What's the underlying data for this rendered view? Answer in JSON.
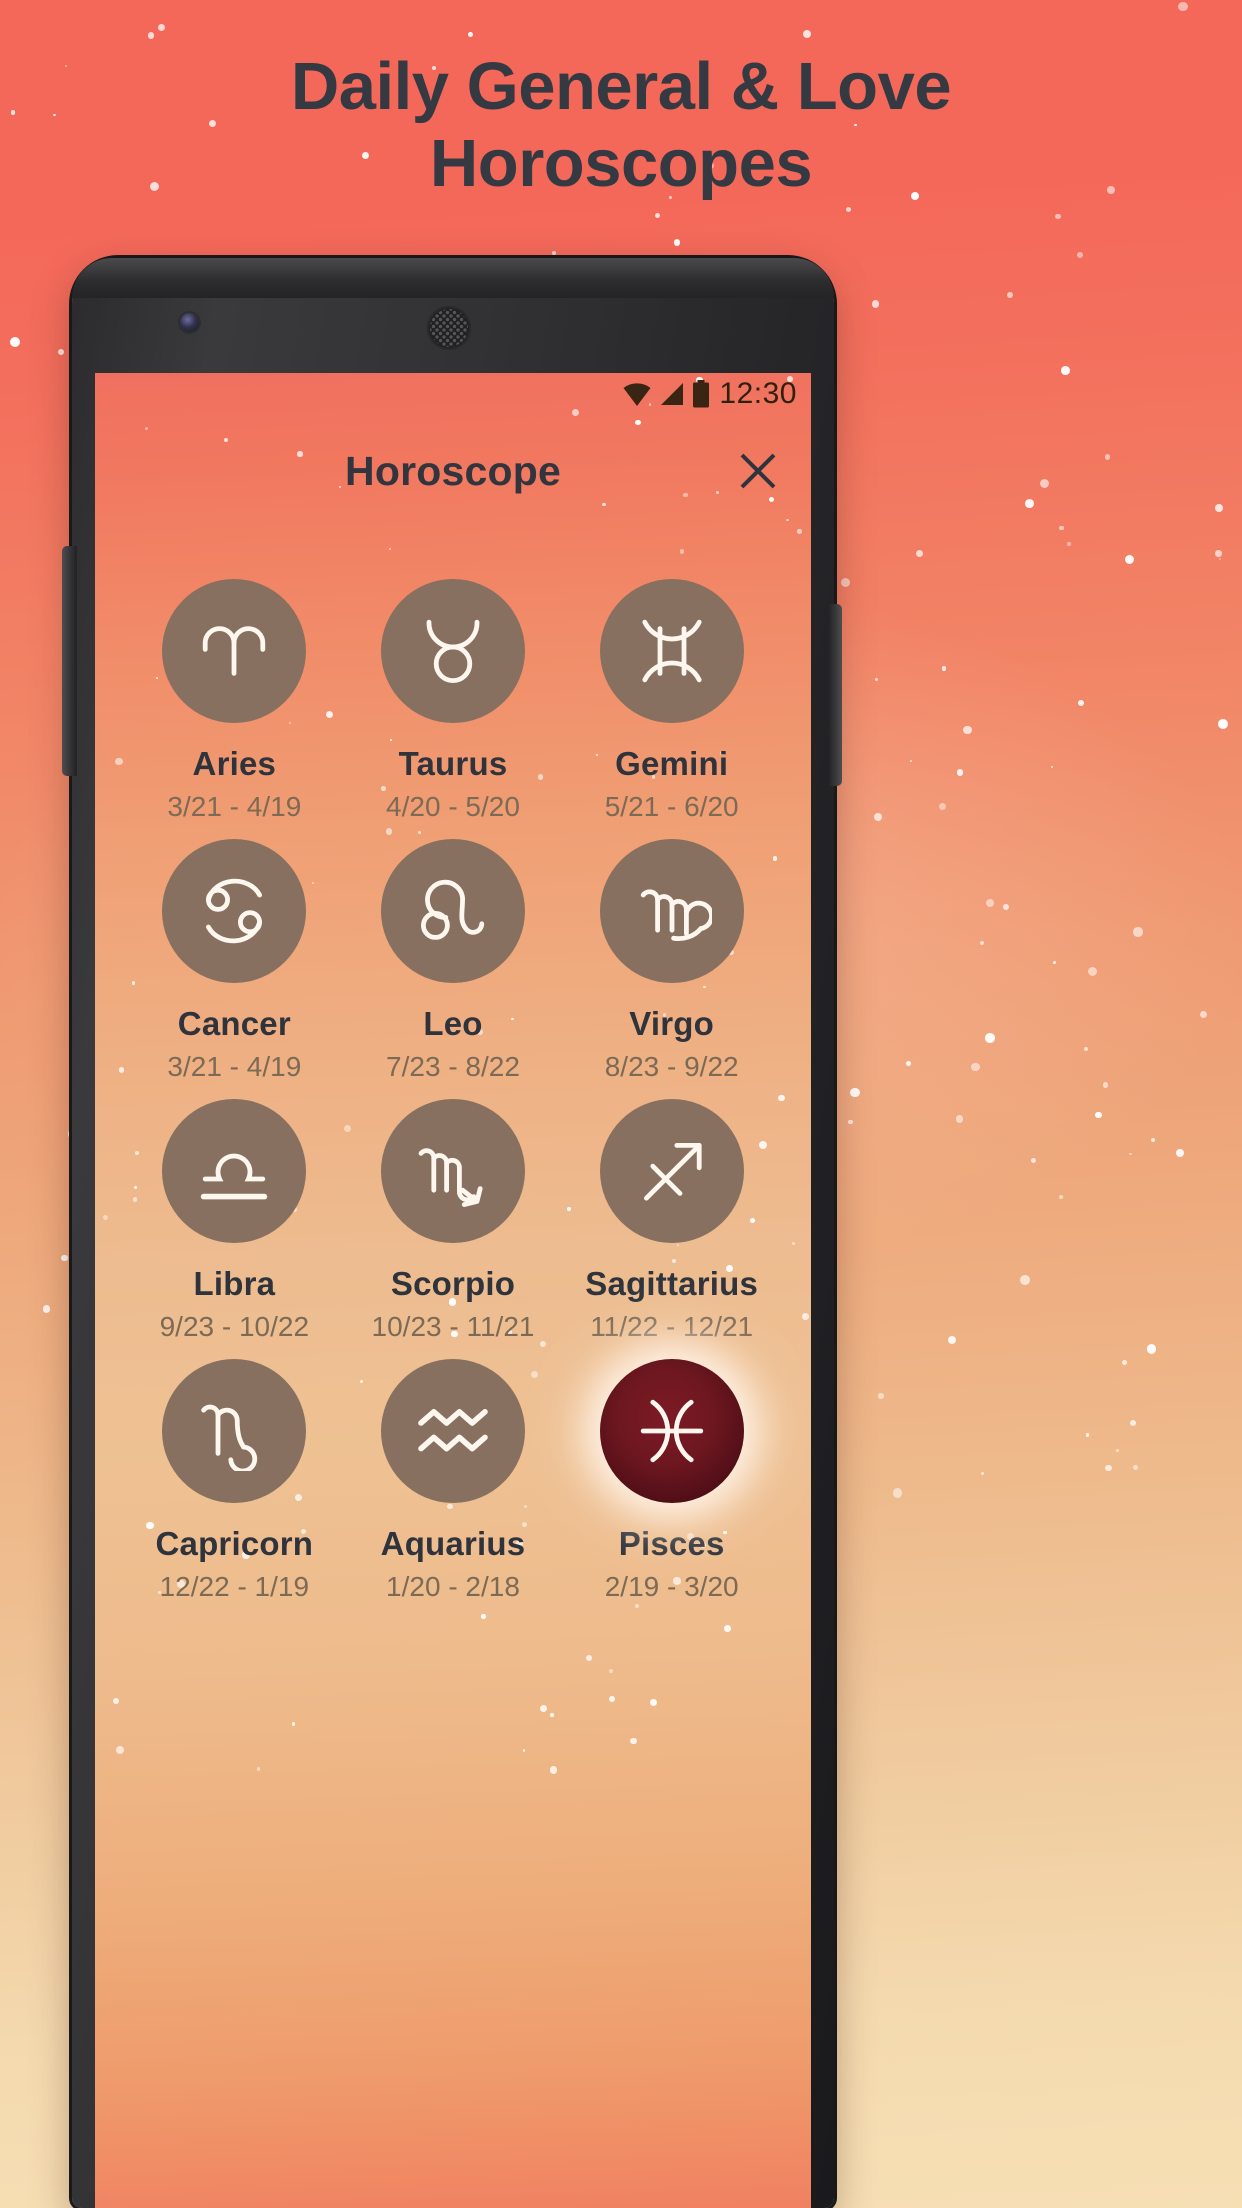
{
  "promo": {
    "heading_line1": "Daily General & Love",
    "heading_line2": "Horoscopes",
    "background_top_color": "#f4685a",
    "background_bottom_color": "#f7dfb4",
    "heading_color": "#353a42"
  },
  "phone": {
    "status_bar": {
      "wifi_icon": "wifi-icon",
      "signal_icon": "signal-icon",
      "battery_icon": "battery-icon",
      "time": "12:30"
    },
    "header": {
      "title": "Horoscope",
      "close_icon": "close-icon",
      "title_color": "#32353d"
    }
  },
  "colors": {
    "circle_default": "#87705f",
    "circle_selected": "#6d1720",
    "glyph": "#fdf7f0",
    "name_text": "#2f333b",
    "date_text": "#7d6a55"
  },
  "zodiac": [
    {
      "name": "Aries",
      "dates": "3/21 - 4/19",
      "glyph": "aries-icon",
      "selected": false
    },
    {
      "name": "Taurus",
      "dates": "4/20 - 5/20",
      "glyph": "taurus-icon",
      "selected": false
    },
    {
      "name": "Gemini",
      "dates": "5/21 - 6/20",
      "glyph": "gemini-icon",
      "selected": false
    },
    {
      "name": "Cancer",
      "dates": "3/21 - 4/19",
      "glyph": "cancer-icon",
      "selected": false
    },
    {
      "name": "Leo",
      "dates": "7/23 - 8/22",
      "glyph": "leo-icon",
      "selected": false
    },
    {
      "name": "Virgo",
      "dates": "8/23 - 9/22",
      "glyph": "virgo-icon",
      "selected": false
    },
    {
      "name": "Libra",
      "dates": "9/23 - 10/22",
      "glyph": "libra-icon",
      "selected": false
    },
    {
      "name": "Scorpio",
      "dates": "10/23 - 11/21",
      "glyph": "scorpio-icon",
      "selected": false
    },
    {
      "name": "Sagittarius",
      "dates": "11/22 - 12/21",
      "glyph": "sagittarius-icon",
      "selected": false
    },
    {
      "name": "Capricorn",
      "dates": "12/22 - 1/19",
      "glyph": "capricorn-icon",
      "selected": false
    },
    {
      "name": "Aquarius",
      "dates": "1/20 - 2/18",
      "glyph": "aquarius-icon",
      "selected": false
    },
    {
      "name": "Pisces",
      "dates": "2/19 - 3/20",
      "glyph": "pisces-icon",
      "selected": true
    }
  ]
}
